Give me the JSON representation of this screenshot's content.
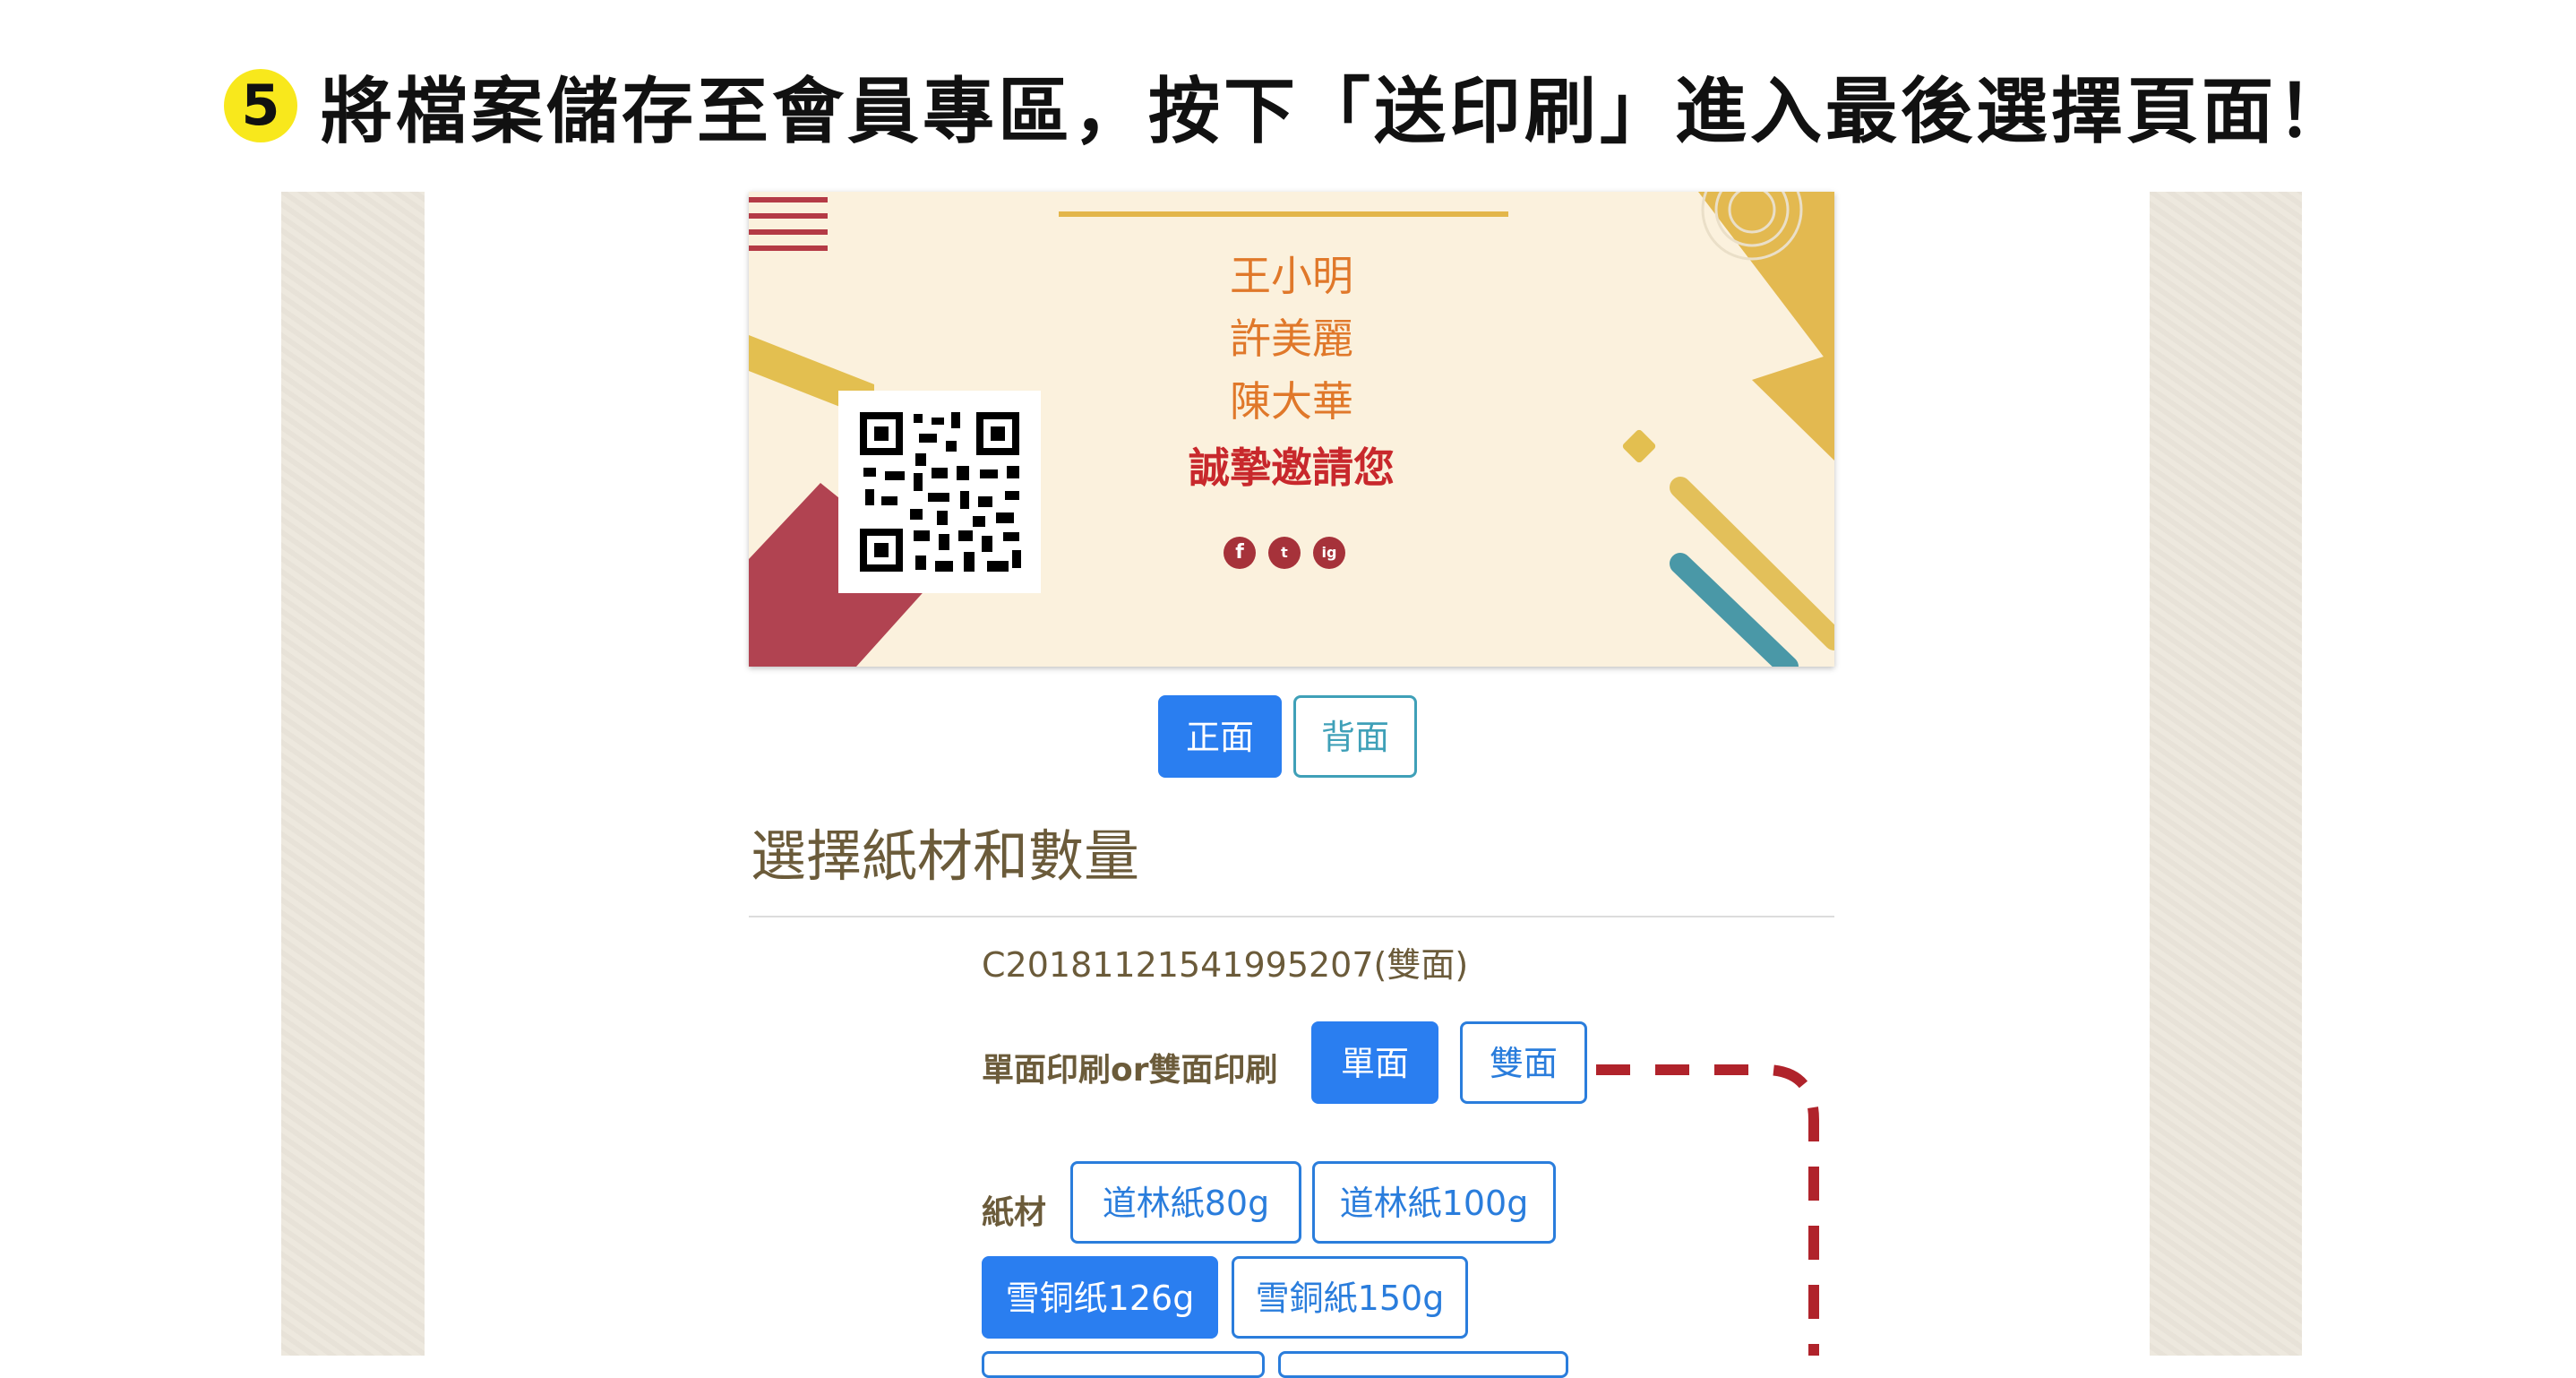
{
  "header": {
    "step": "5",
    "text": "將檔案儲存至會員專區，按下「送印刷」進入最後選擇頁面！"
  },
  "card": {
    "names": [
      "王小明",
      "許美麗",
      "陳大華"
    ],
    "invite": "誠摯邀請您",
    "social": [
      "f",
      "t",
      "ig"
    ]
  },
  "view_toggle": {
    "front": "正面",
    "back": "背面"
  },
  "section_title": "選擇紙材和數量",
  "order_code": "C20181121541995207(雙面)",
  "print_side": {
    "label": "單面印刷or雙面印刷",
    "single": "單面",
    "double": "雙面"
  },
  "paper": {
    "label": "紙材",
    "options": [
      "道林紙80g",
      "道林紙100g",
      "雪铜纸126g",
      "雪銅紙150g"
    ]
  },
  "colors": {
    "accent": "#2a7ef0",
    "annotation": "#b0232b",
    "badge": "#f8e81c"
  }
}
